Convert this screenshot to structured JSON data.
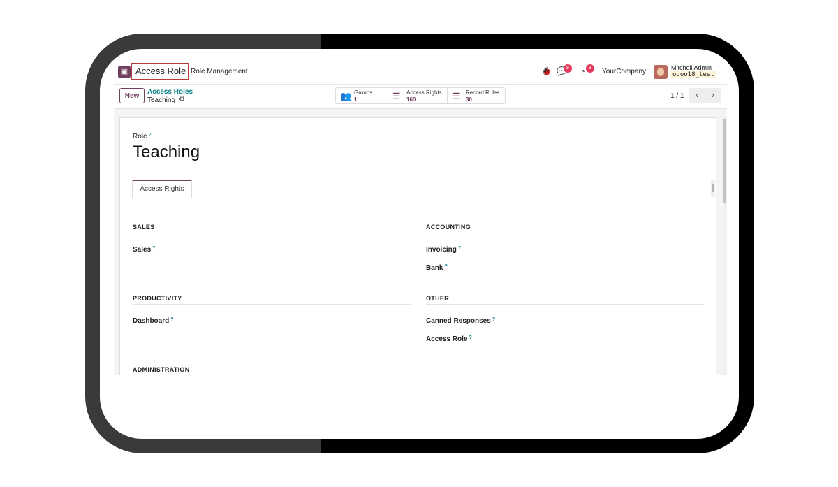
{
  "navbar": {
    "app_name": "Access Role",
    "menu_item": "Role Management",
    "chat_count": "8",
    "activity_count": "8",
    "company": "YourCompany",
    "user_name": "Mitchell Admin",
    "database": "odoo18_test"
  },
  "control_panel": {
    "new_button": "New",
    "breadcrumb_parent": "Access Roles",
    "breadcrumb_current": "Teaching",
    "stats": [
      {
        "label": "Groups",
        "value": "1",
        "icon": "users-icon"
      },
      {
        "label": "Access Rights",
        "value": "160",
        "icon": "list-icon"
      },
      {
        "label": "Record Rules",
        "value": "30",
        "icon": "list-icon"
      }
    ],
    "pager": "1 / 1"
  },
  "form": {
    "role_label": "Role",
    "help_mark": "?",
    "role_name": "Teaching",
    "tab": "Access Rights",
    "sections": [
      {
        "title": "SALES",
        "apps": [
          "Sales"
        ]
      },
      {
        "title": "ACCOUNTING",
        "apps": [
          "Invoicing",
          "Bank"
        ]
      },
      {
        "title": "PRODUCTIVITY",
        "apps": [
          "Dashboard"
        ]
      },
      {
        "title": "OTHER",
        "apps": [
          "Canned Responses",
          "Access Role"
        ]
      },
      {
        "title": "ADMINISTRATION",
        "apps": []
      }
    ]
  },
  "colors": {
    "brand": "#71405f",
    "link": "#017e84",
    "badge": "#e43b5c",
    "highlight_border": "#b73a3a"
  }
}
